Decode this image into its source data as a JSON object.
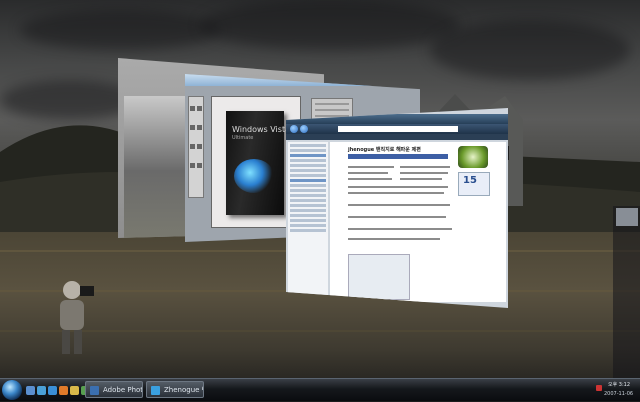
{
  "desktop": {
    "windows": {
      "photoshop": {
        "box_title": "Windows Vista",
        "box_subtitle": "Ultimate"
      },
      "browser": {
        "site_name": "jhenogue 밴직지로 해파운 제편",
        "calendar_day": "15"
      }
    }
  },
  "taskbar": {
    "tasks": [
      {
        "label": "Adobe Photoshop",
        "icon": "photoshop-icon",
        "color": "#3b6fb0"
      },
      {
        "label": "Zhenogue 밴직지로 ...",
        "icon": "internet-explorer-icon",
        "color": "#3aa0e0"
      }
    ],
    "quick_launch": [
      {
        "icon": "show-desktop-icon",
        "color": "#5b8fd0"
      },
      {
        "icon": "switch-windows-icon",
        "color": "#4aa0d8"
      },
      {
        "icon": "internet-explorer-icon",
        "color": "#3a8fd8"
      },
      {
        "icon": "media-player-icon",
        "color": "#e07a2a"
      },
      {
        "icon": "explorer-icon",
        "color": "#d8b84a"
      },
      {
        "icon": "app-icon",
        "color": "#58a050"
      }
    ],
    "clock_time": "오후 3:12",
    "clock_day": "화요일",
    "clock_date": "2007-11-06"
  }
}
